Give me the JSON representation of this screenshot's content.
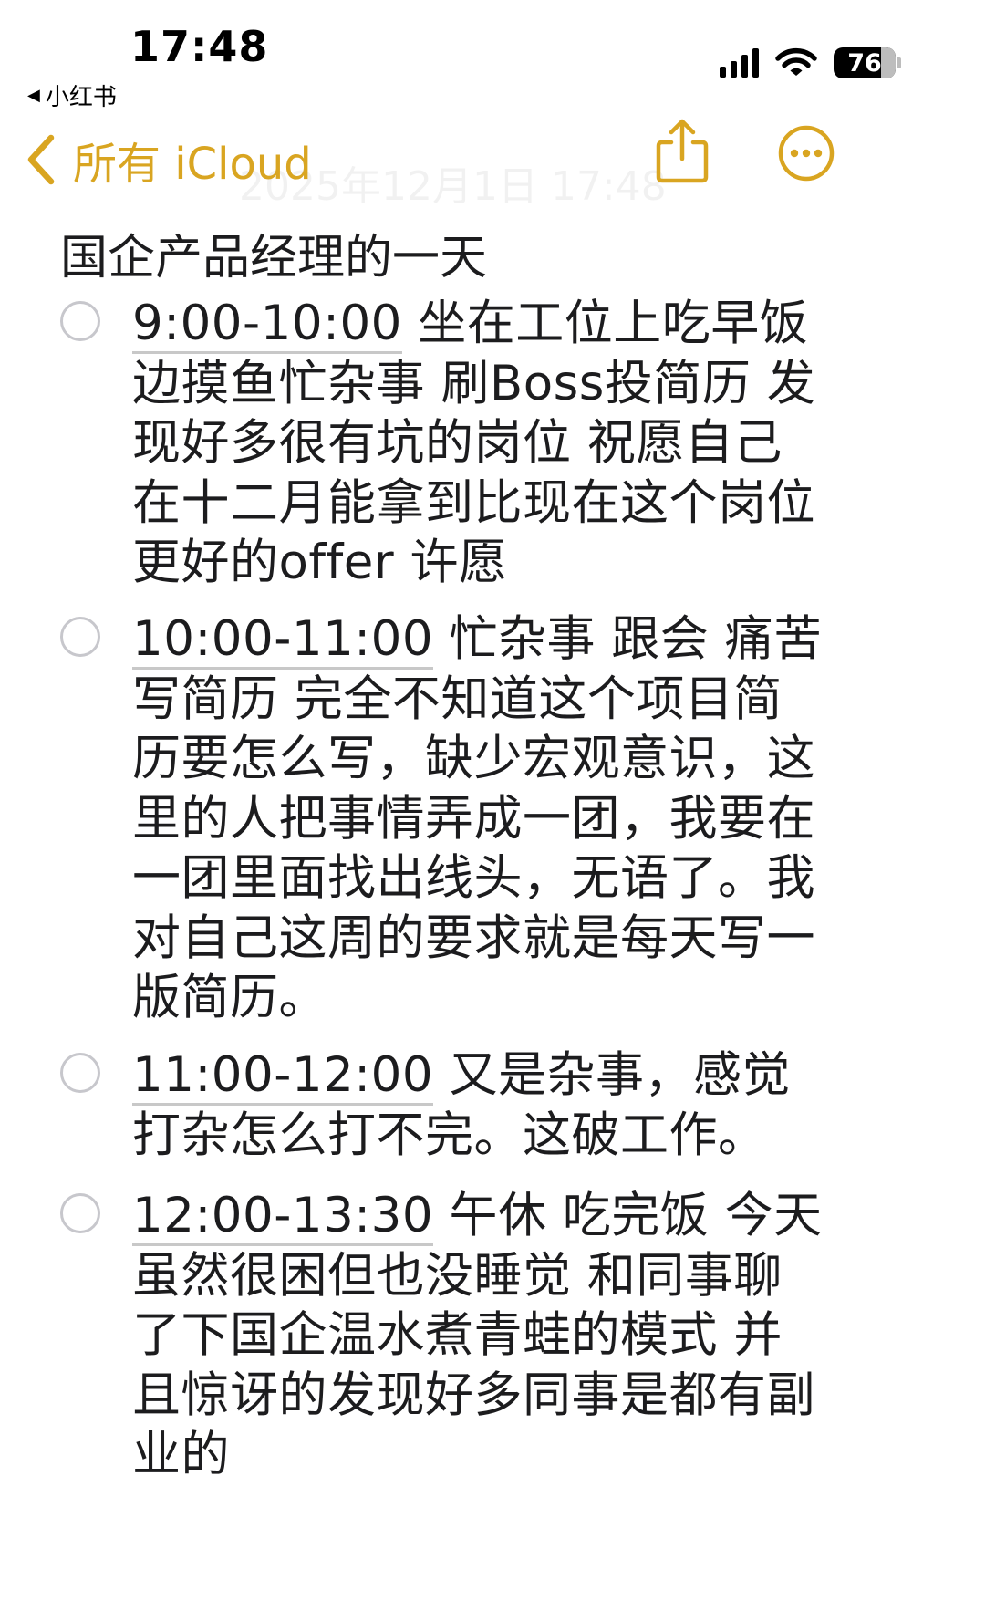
{
  "status_bar": {
    "time": "17:48",
    "back_app": "小红书",
    "battery": "76"
  },
  "nav": {
    "back_label": "所有 iCloud",
    "faint_date": "2025年12月1日 17:48"
  },
  "note": {
    "title": "国企产品经理的一天",
    "items": [
      {
        "time": "9:00-10:00",
        "text": " 坐在工位上吃早饭 边摸鱼忙杂事 刷Boss投简历 发现好多很有坑的岗位 祝愿自己在十二月能拿到比现在这个岗位更好的offer 许愿"
      },
      {
        "time": "10:00-11:00",
        "text": " 忙杂事 跟会 痛苦写简历 完全不知道这个项目简历要怎么写，缺少宏观意识，这里的人把事情弄成一团，我要在一团里面找出线头，无语了。我对自己这周的要求就是每天写一版简历。"
      },
      {
        "time": "11:00-12:00",
        "text": " 又是杂事，感觉打杂怎么打不完。这破工作。"
      },
      {
        "time": "12:00-13:30",
        "text": " 午休 吃完饭 今天虽然很困但也没睡觉 和同事聊了下国企温水煮青蛙的模式 并且惊讶的发现好多同事是都有副业的"
      }
    ]
  },
  "colors": {
    "accent": "#d9a521",
    "text": "#1c1c1e",
    "checkbox": "#c7c7cc"
  },
  "icons": {
    "back": "chevron-left-icon",
    "share": "share-icon",
    "more": "ellipsis-circle-icon"
  }
}
